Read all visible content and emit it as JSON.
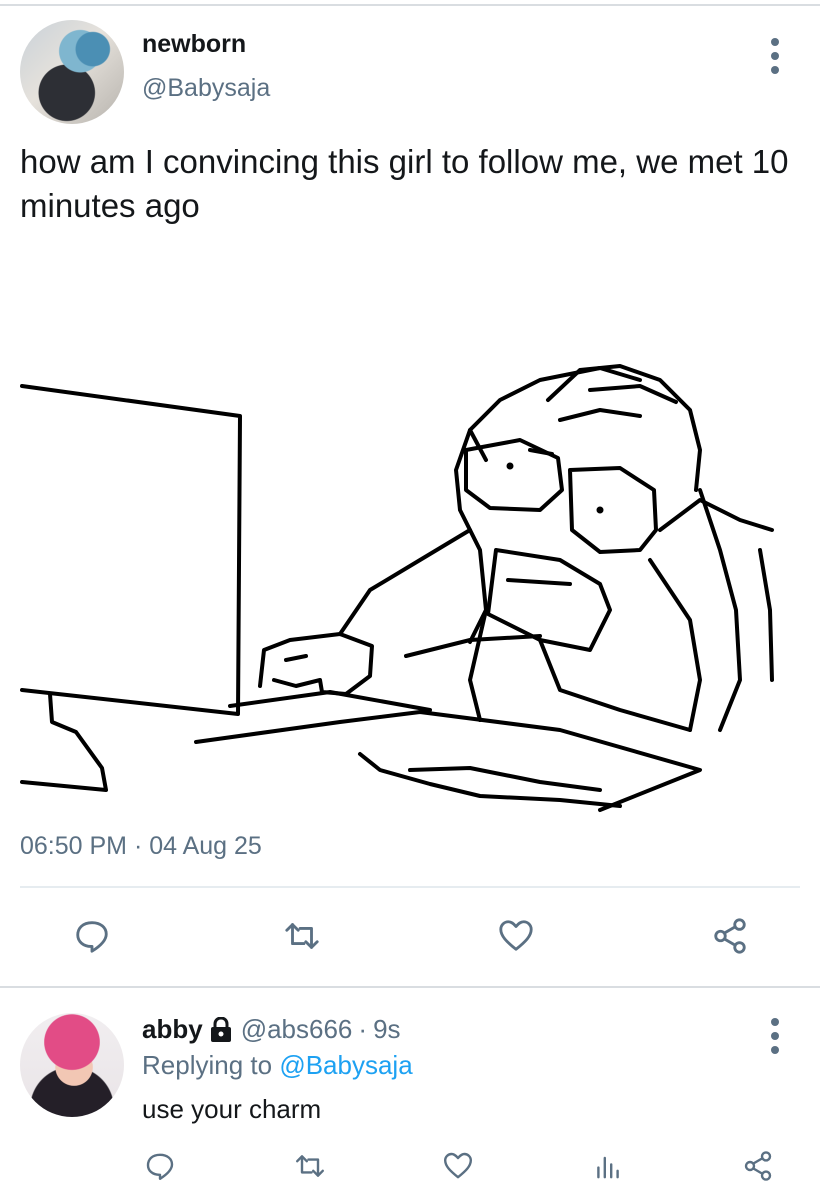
{
  "tweet": {
    "author_name": "newborn",
    "author_handle": "@Babysaja",
    "text": "how am I convincing this girl to follow me, we met 10 minutes ago",
    "timestamp": "06:50 PM · 04 Aug 25",
    "avatar_icon": "user-avatar-photo",
    "media": "computer-stress-sketch"
  },
  "actions": [
    "reply-icon",
    "retweet-icon",
    "like-icon",
    "share-icon"
  ],
  "reply": {
    "author_name": "abby",
    "author_handle": "@abs666",
    "separator": "·",
    "time": "9s",
    "replying_prefix": "Replying to ",
    "replying_mention": "@Babysaja",
    "text": "use your charm",
    "avatar_icon": "user-avatar-photo",
    "locked": true,
    "actions": [
      "reply-icon",
      "retweet-icon",
      "like-icon",
      "analytics-icon",
      "share-icon"
    ]
  },
  "colors": {
    "text": "#14171a",
    "secondary": "#5b7083",
    "link": "#1da1f2",
    "icon": "#5b7083",
    "divider": "#e6ecf0"
  }
}
